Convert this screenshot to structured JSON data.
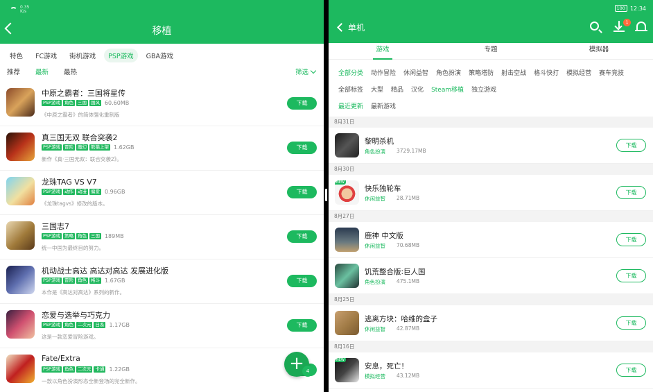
{
  "left": {
    "status": {
      "speed": "0.35",
      "speed_unit": "K/s"
    },
    "title": "移植",
    "categories": [
      {
        "label": "特色",
        "active": false
      },
      {
        "label": "FC游戏",
        "active": false
      },
      {
        "label": "街机游戏",
        "active": false
      },
      {
        "label": "PSP游戏",
        "active": true
      },
      {
        "label": "GBA游戏",
        "active": false
      }
    ],
    "sort": [
      {
        "label": "推荐",
        "active": false
      },
      {
        "label": "最新",
        "active": true
      },
      {
        "label": "最热",
        "active": false
      }
    ],
    "filter_label": "筛选",
    "download_label": "下载",
    "fab_label": "+",
    "fab_count": "4",
    "games": [
      {
        "name": "中原之霸者：三国将星传",
        "tags": [
          "PSP游戏",
          "角色",
          "三国",
          "国风"
        ],
        "size": "60.60MB",
        "desc": "《中原之霸者》的简体强化重制版"
      },
      {
        "name": "真三国无双 联合突袭2",
        "tags": [
          "PSP游戏",
          "冒险",
          "魔幻",
          "熊猫上架"
        ],
        "size": "1.62GB",
        "desc": "新作《真·三国无双：联合突袭2》。"
      },
      {
        "name": "龙珠TAG VS V7",
        "tags": [
          "PSP游戏",
          "动作",
          "动漫",
          "偏爱"
        ],
        "size": "0.96GB",
        "desc": "《龙珠tagvs》修改的版本。"
      },
      {
        "name": "三国志7",
        "tags": [
          "PSP游戏",
          "策略",
          "角色",
          "三国"
        ],
        "size": "189MB",
        "desc": "统一中国为最终目的努力。"
      },
      {
        "name": "机动战士高达 高达对高达 发展进化版",
        "tags": [
          "PSP游戏",
          "冒险",
          "角色",
          "格斗"
        ],
        "size": "1.67GB",
        "desc": "本作是《高达对高达》系列的新作。"
      },
      {
        "name": "恋爱与选举与巧克力",
        "tags": [
          "PSP游戏",
          "角色",
          "二次元",
          "日系"
        ],
        "size": "1.17GB",
        "desc": "这是一款恋爱冒险游戏。"
      },
      {
        "name": "Fate/Extra",
        "tags": [
          "PSP游戏",
          "角色",
          "二次元",
          "卡通"
        ],
        "size": "1.22GB",
        "desc": "一款以角色扮演形态全新登场的完全新作。"
      }
    ]
  },
  "right": {
    "status": {
      "battery": "100",
      "time": "12:34"
    },
    "title": "单机",
    "download_badge": "1",
    "tabs": [
      {
        "label": "游戏",
        "active": true
      },
      {
        "label": "专题",
        "active": false
      },
      {
        "label": "模拟器",
        "active": false
      }
    ],
    "cat_row1": [
      {
        "label": "全部分类",
        "active": true
      },
      {
        "label": "动作冒险",
        "active": false
      },
      {
        "label": "休闲益智",
        "active": false
      },
      {
        "label": "角色扮演",
        "active": false
      },
      {
        "label": "策略塔防",
        "active": false
      },
      {
        "label": "射击空战",
        "active": false
      },
      {
        "label": "格斗快打",
        "active": false
      },
      {
        "label": "模拟经营",
        "active": false
      },
      {
        "label": "赛车竞技",
        "active": false
      }
    ],
    "cat_row2": [
      {
        "label": "全部标签",
        "active": false
      },
      {
        "label": "大型",
        "active": false
      },
      {
        "label": "精品",
        "active": false
      },
      {
        "label": "汉化",
        "active": false
      },
      {
        "label": "Steam移植",
        "active": true
      },
      {
        "label": "独立游戏",
        "active": false
      }
    ],
    "cat_row3": [
      {
        "label": "最近更新",
        "active": true
      },
      {
        "label": "最新游戏",
        "active": false
      }
    ],
    "download_label": "下载",
    "new_badge": "NEW",
    "groups": [
      {
        "date": "8月31日",
        "items": [
          {
            "name": "黎明杀机",
            "cat": "角色扮演",
            "size": "3729.17MB",
            "new": false
          }
        ]
      },
      {
        "date": "8月30日",
        "items": [
          {
            "name": "快乐独轮车",
            "cat": "休闲益智",
            "size": "28.71MB",
            "new": true
          }
        ]
      },
      {
        "date": "8月27日",
        "items": [
          {
            "name": "鹿神 中文版",
            "cat": "休闲益智",
            "size": "70.68MB",
            "new": false
          },
          {
            "name": "饥荒整合版:巨人国",
            "cat": "角色扮演",
            "size": "475.1MB",
            "new": false
          }
        ]
      },
      {
        "date": "8月25日",
        "items": [
          {
            "name": "逃离方块：哈维的盒子",
            "cat": "休闲益智",
            "size": "42.87MB",
            "new": false
          }
        ]
      },
      {
        "date": "8月16日",
        "items": [
          {
            "name": "安息，死亡！",
            "cat": "模拟经营",
            "size": "43.12MB",
            "new": true
          }
        ]
      }
    ]
  }
}
